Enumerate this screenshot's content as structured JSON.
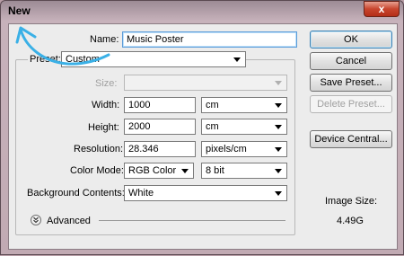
{
  "window": {
    "title": "New",
    "close_glyph": "x"
  },
  "form": {
    "name_label": "Name:",
    "name_value": "Music Poster",
    "preset_label": "Preset:",
    "preset_value": "Custom",
    "size_label": "Size:",
    "size_value": "",
    "width_label": "Width:",
    "width_value": "1000",
    "width_unit": "cm",
    "height_label": "Height:",
    "height_value": "2000",
    "height_unit": "cm",
    "resolution_label": "Resolution:",
    "resolution_value": "28.346",
    "resolution_unit": "pixels/cm",
    "color_mode_label": "Color Mode:",
    "color_mode_value": "RGB Color",
    "bit_depth_value": "8 bit",
    "background_label": "Background Contents:",
    "background_value": "White",
    "advanced_label": "Advanced"
  },
  "buttons": {
    "ok": "OK",
    "cancel": "Cancel",
    "save_preset": "Save Preset...",
    "delete_preset": "Delete Preset...",
    "device_central": "Device Central..."
  },
  "image_size": {
    "label": "Image Size:",
    "value": "4.49G"
  },
  "icons": {
    "chevron": "chevron-down-icon",
    "advanced": "double-chevron-down-icon",
    "annotation": "blue-swoosh-arrow"
  },
  "colors": {
    "title_bar": "#b89ea7",
    "dialog_bg": "#ececec",
    "default_button_border": "#3c7fb1",
    "annotation_stroke": "#3ab0e6"
  }
}
